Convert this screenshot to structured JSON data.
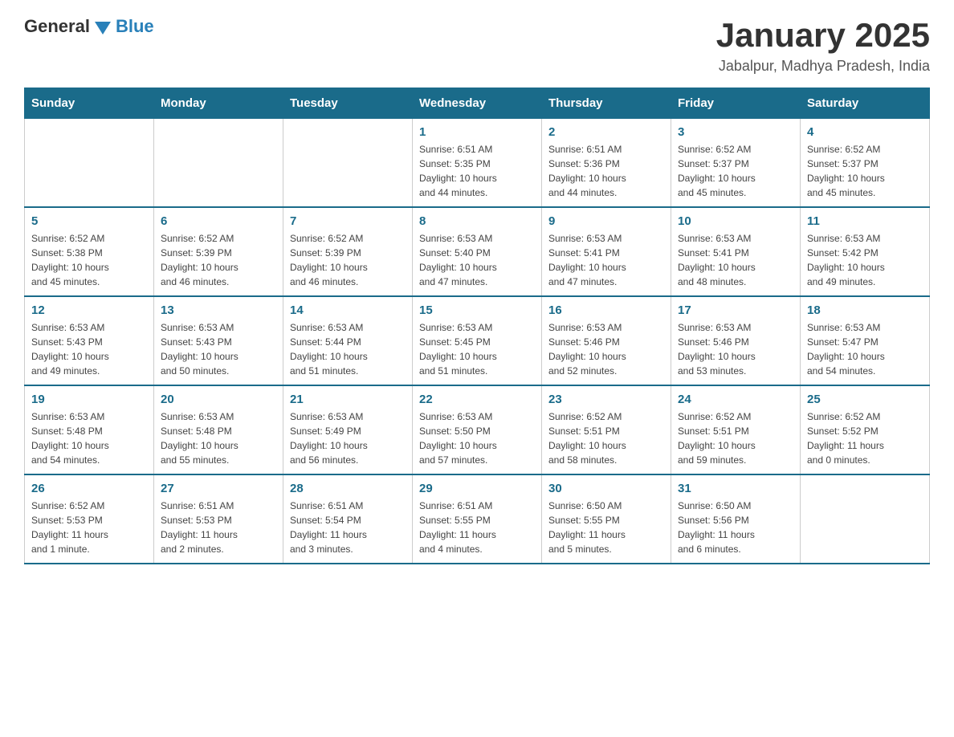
{
  "logo": {
    "general": "General",
    "blue": "Blue"
  },
  "header": {
    "title": "January 2025",
    "subtitle": "Jabalpur, Madhya Pradesh, India"
  },
  "days_of_week": [
    "Sunday",
    "Monday",
    "Tuesday",
    "Wednesday",
    "Thursday",
    "Friday",
    "Saturday"
  ],
  "weeks": [
    [
      {
        "day": "",
        "info": ""
      },
      {
        "day": "",
        "info": ""
      },
      {
        "day": "",
        "info": ""
      },
      {
        "day": "1",
        "info": "Sunrise: 6:51 AM\nSunset: 5:35 PM\nDaylight: 10 hours\nand 44 minutes."
      },
      {
        "day": "2",
        "info": "Sunrise: 6:51 AM\nSunset: 5:36 PM\nDaylight: 10 hours\nand 44 minutes."
      },
      {
        "day": "3",
        "info": "Sunrise: 6:52 AM\nSunset: 5:37 PM\nDaylight: 10 hours\nand 45 minutes."
      },
      {
        "day": "4",
        "info": "Sunrise: 6:52 AM\nSunset: 5:37 PM\nDaylight: 10 hours\nand 45 minutes."
      }
    ],
    [
      {
        "day": "5",
        "info": "Sunrise: 6:52 AM\nSunset: 5:38 PM\nDaylight: 10 hours\nand 45 minutes."
      },
      {
        "day": "6",
        "info": "Sunrise: 6:52 AM\nSunset: 5:39 PM\nDaylight: 10 hours\nand 46 minutes."
      },
      {
        "day": "7",
        "info": "Sunrise: 6:52 AM\nSunset: 5:39 PM\nDaylight: 10 hours\nand 46 minutes."
      },
      {
        "day": "8",
        "info": "Sunrise: 6:53 AM\nSunset: 5:40 PM\nDaylight: 10 hours\nand 47 minutes."
      },
      {
        "day": "9",
        "info": "Sunrise: 6:53 AM\nSunset: 5:41 PM\nDaylight: 10 hours\nand 47 minutes."
      },
      {
        "day": "10",
        "info": "Sunrise: 6:53 AM\nSunset: 5:41 PM\nDaylight: 10 hours\nand 48 minutes."
      },
      {
        "day": "11",
        "info": "Sunrise: 6:53 AM\nSunset: 5:42 PM\nDaylight: 10 hours\nand 49 minutes."
      }
    ],
    [
      {
        "day": "12",
        "info": "Sunrise: 6:53 AM\nSunset: 5:43 PM\nDaylight: 10 hours\nand 49 minutes."
      },
      {
        "day": "13",
        "info": "Sunrise: 6:53 AM\nSunset: 5:43 PM\nDaylight: 10 hours\nand 50 minutes."
      },
      {
        "day": "14",
        "info": "Sunrise: 6:53 AM\nSunset: 5:44 PM\nDaylight: 10 hours\nand 51 minutes."
      },
      {
        "day": "15",
        "info": "Sunrise: 6:53 AM\nSunset: 5:45 PM\nDaylight: 10 hours\nand 51 minutes."
      },
      {
        "day": "16",
        "info": "Sunrise: 6:53 AM\nSunset: 5:46 PM\nDaylight: 10 hours\nand 52 minutes."
      },
      {
        "day": "17",
        "info": "Sunrise: 6:53 AM\nSunset: 5:46 PM\nDaylight: 10 hours\nand 53 minutes."
      },
      {
        "day": "18",
        "info": "Sunrise: 6:53 AM\nSunset: 5:47 PM\nDaylight: 10 hours\nand 54 minutes."
      }
    ],
    [
      {
        "day": "19",
        "info": "Sunrise: 6:53 AM\nSunset: 5:48 PM\nDaylight: 10 hours\nand 54 minutes."
      },
      {
        "day": "20",
        "info": "Sunrise: 6:53 AM\nSunset: 5:48 PM\nDaylight: 10 hours\nand 55 minutes."
      },
      {
        "day": "21",
        "info": "Sunrise: 6:53 AM\nSunset: 5:49 PM\nDaylight: 10 hours\nand 56 minutes."
      },
      {
        "day": "22",
        "info": "Sunrise: 6:53 AM\nSunset: 5:50 PM\nDaylight: 10 hours\nand 57 minutes."
      },
      {
        "day": "23",
        "info": "Sunrise: 6:52 AM\nSunset: 5:51 PM\nDaylight: 10 hours\nand 58 minutes."
      },
      {
        "day": "24",
        "info": "Sunrise: 6:52 AM\nSunset: 5:51 PM\nDaylight: 10 hours\nand 59 minutes."
      },
      {
        "day": "25",
        "info": "Sunrise: 6:52 AM\nSunset: 5:52 PM\nDaylight: 11 hours\nand 0 minutes."
      }
    ],
    [
      {
        "day": "26",
        "info": "Sunrise: 6:52 AM\nSunset: 5:53 PM\nDaylight: 11 hours\nand 1 minute."
      },
      {
        "day": "27",
        "info": "Sunrise: 6:51 AM\nSunset: 5:53 PM\nDaylight: 11 hours\nand 2 minutes."
      },
      {
        "day": "28",
        "info": "Sunrise: 6:51 AM\nSunset: 5:54 PM\nDaylight: 11 hours\nand 3 minutes."
      },
      {
        "day": "29",
        "info": "Sunrise: 6:51 AM\nSunset: 5:55 PM\nDaylight: 11 hours\nand 4 minutes."
      },
      {
        "day": "30",
        "info": "Sunrise: 6:50 AM\nSunset: 5:55 PM\nDaylight: 11 hours\nand 5 minutes."
      },
      {
        "day": "31",
        "info": "Sunrise: 6:50 AM\nSunset: 5:56 PM\nDaylight: 11 hours\nand 6 minutes."
      },
      {
        "day": "",
        "info": ""
      }
    ]
  ]
}
